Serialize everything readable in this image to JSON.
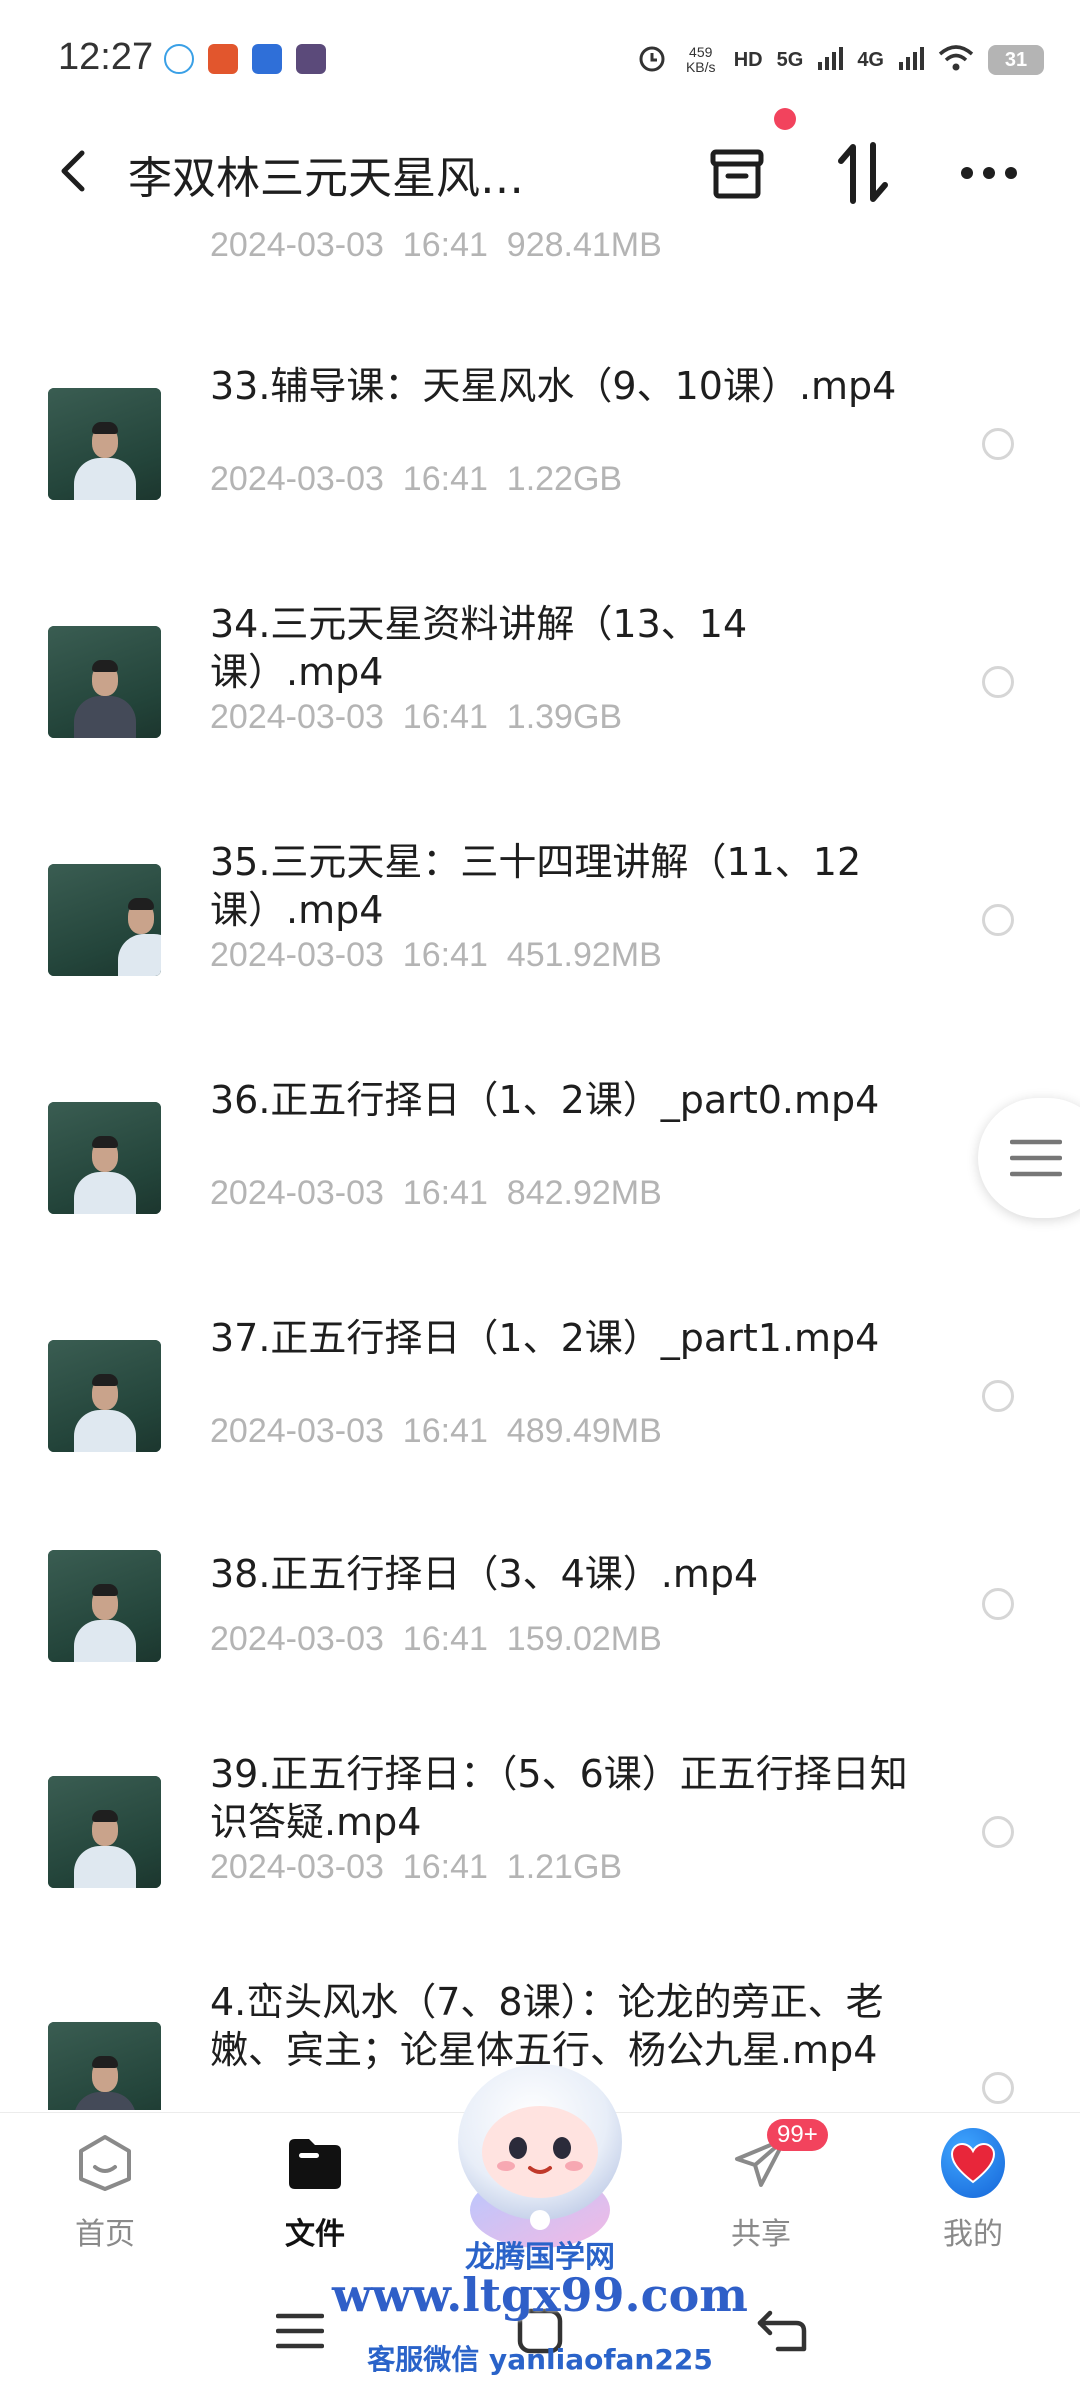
{
  "status_bar": {
    "time": "12:27",
    "net_speed_value": "459",
    "net_speed_unit": "KB/s",
    "hd_label": "HD",
    "network_5g": "5G",
    "network_4g": "4G",
    "battery": "31"
  },
  "header": {
    "title": "李双林三元天星风…",
    "back_icon": "chevron-left-icon",
    "archive_icon": "archive-box-icon",
    "sort_icon": "sort-arrows-icon",
    "more_icon": "more-dots-icon",
    "notification_dot_color": "#f2435d"
  },
  "files": {
    "partial_meta": "2024-03-03  16:41  928.41MB",
    "items": [
      {
        "title": "33.辅导课：天星风水（9、10课）.mp4",
        "meta": "2024-03-03  16:41  1.22GB"
      },
      {
        "title": "34.三元天星资料讲解（13、14课）.mp4",
        "meta": "2024-03-03  16:41  1.39GB"
      },
      {
        "title": "35.三元天星：三十四理讲解（11、12课）.mp4",
        "meta": "2024-03-03  16:41  451.92MB"
      },
      {
        "title": "36.正五行择日（1、2课）_part0.mp4",
        "meta": "2024-03-03  16:41  842.92MB"
      },
      {
        "title": "37.正五行择日（1、2课）_part1.mp4",
        "meta": "2024-03-03  16:41  489.49MB"
      },
      {
        "title": "38.正五行择日（3、4课）.mp4",
        "meta": "2024-03-03  16:41  159.02MB"
      },
      {
        "title": "39.正五行择日：（5、6课）正五行择日知识答疑.mp4",
        "meta": "2024-03-03  16:41  1.21GB"
      },
      {
        "title": "4.峦头风水（7、8课）：论龙的旁正、老嫩、宾主；论星体五行、杨公九星.mp4",
        "meta": ""
      }
    ]
  },
  "bottom_nav": {
    "items": [
      {
        "label": "首页",
        "icon": "home-face-icon"
      },
      {
        "label": "文件",
        "icon": "folder-icon"
      },
      {
        "label": "共享",
        "icon": "paper-plane-icon",
        "badge": "99+"
      },
      {
        "label": "我的",
        "icon": "heart-avatar-icon"
      }
    ],
    "active_color": "#111111",
    "inactive_color": "#8a8a8a"
  },
  "watermark": {
    "site_name": "龙腾国学网",
    "url": "www.ltgx99.com",
    "contact": "客服微信 yanliaofan225"
  },
  "system_nav": {
    "menu_icon": "menu-lines-icon",
    "home_icon": "home-square-icon",
    "back_icon": "back-arrow-icon"
  }
}
